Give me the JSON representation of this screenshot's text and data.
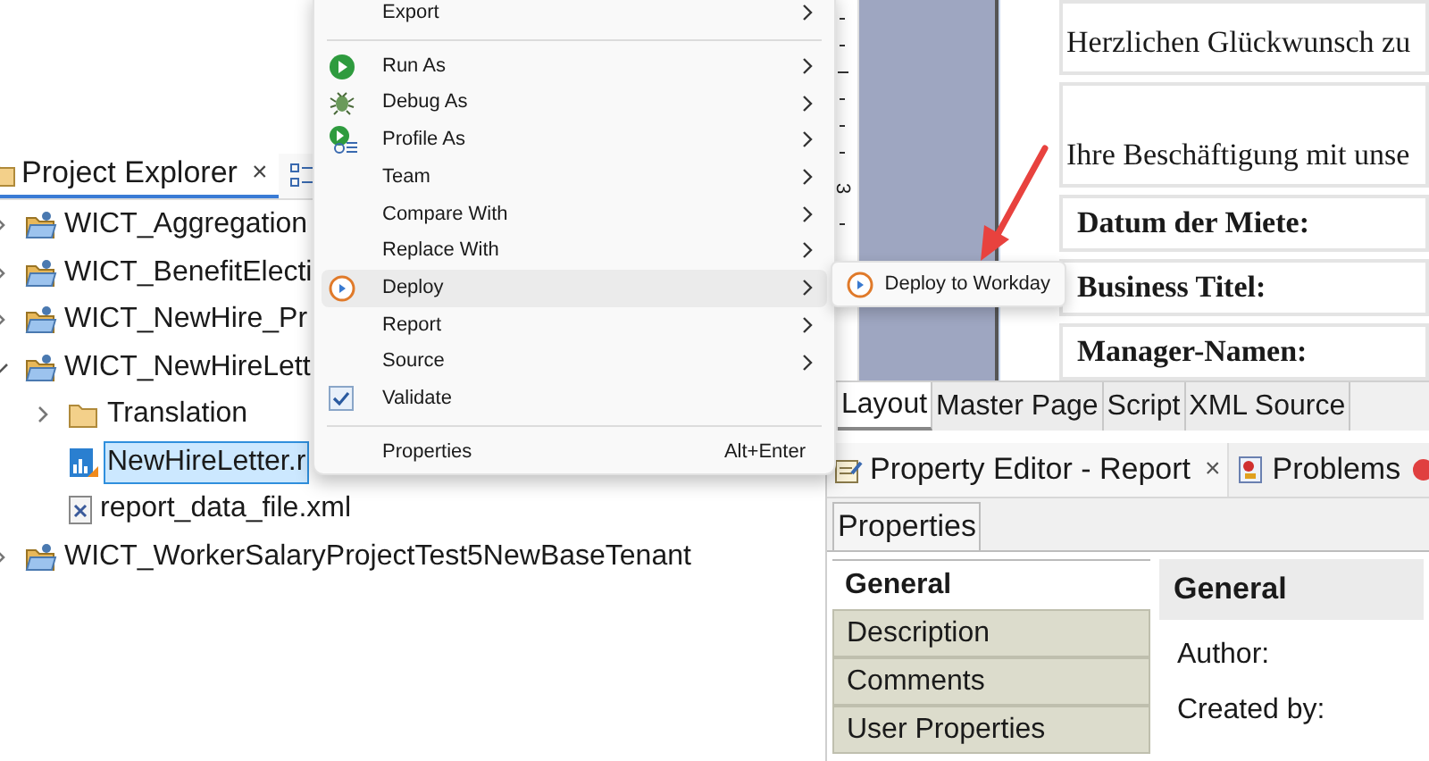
{
  "project_explorer": {
    "tab": {
      "label": "Project Explorer",
      "close": "×",
      "selected": true
    },
    "tree": [
      {
        "label": "WICT_Aggregation",
        "expanded": false
      },
      {
        "label": "WICT_BenefitElecti",
        "expanded": false
      },
      {
        "label": "WICT_NewHire_Pr",
        "expanded": false
      },
      {
        "label": "WICT_NewHireLett",
        "expanded": true,
        "children": [
          {
            "label": "Translation",
            "kind": "folder",
            "expanded": false,
            "selected": false
          },
          {
            "label": "NewHireLetter.r",
            "kind": "report",
            "selected": true
          },
          {
            "label": "report_data_file.xml",
            "kind": "xml",
            "selected": false
          }
        ]
      },
      {
        "label": "WICT_WorkerSalaryProjectTest5NewBaseTenant",
        "expanded": false
      }
    ]
  },
  "context_menu": {
    "items": [
      {
        "kind": "item",
        "label": "Export",
        "submenu": true,
        "selected": false
      },
      {
        "kind": "separator"
      },
      {
        "kind": "item",
        "label": "Run As",
        "submenu": true,
        "selected": false
      },
      {
        "kind": "item",
        "label": "Debug As",
        "submenu": true,
        "selected": false
      },
      {
        "kind": "item",
        "label": "Profile As",
        "submenu": true,
        "selected": false
      },
      {
        "kind": "item",
        "label": "Team",
        "submenu": true,
        "selected": false
      },
      {
        "kind": "item",
        "label": "Compare With",
        "submenu": true,
        "selected": false
      },
      {
        "kind": "item",
        "label": "Replace With",
        "submenu": true,
        "selected": false
      },
      {
        "kind": "item",
        "label": "Deploy",
        "submenu": true,
        "selected": true
      },
      {
        "kind": "item",
        "label": "Report",
        "submenu": true,
        "selected": false
      },
      {
        "kind": "item",
        "label": "Source",
        "submenu": true,
        "selected": false
      },
      {
        "kind": "item",
        "label": "Validate",
        "submenu": false,
        "selected": false
      },
      {
        "kind": "separator"
      },
      {
        "kind": "item",
        "label": "Properties",
        "submenu": false,
        "selected": false,
        "shortcut": "Alt+Enter"
      }
    ],
    "submenu": {
      "items": [
        {
          "label": "Deploy to Workday",
          "selected": false
        }
      ]
    }
  },
  "report_canvas": {
    "ruler_label": "3",
    "blocks": [
      {
        "kind": "text",
        "label": "Herzlichen Glückwunsch zu"
      },
      {
        "kind": "text",
        "label": "Ihre Beschäftigung mit unse"
      },
      {
        "kind": "field",
        "label": "Datum der Miete:"
      },
      {
        "kind": "field",
        "label": "Business Titel:"
      },
      {
        "kind": "field",
        "label": "Manager-Namen:"
      }
    ]
  },
  "editor_tabs": [
    {
      "label": "Layout",
      "selected": true
    },
    {
      "label": "Master Page",
      "selected": false
    },
    {
      "label": "Script",
      "selected": false
    },
    {
      "label": "XML Source",
      "selected": false
    }
  ],
  "property_view": {
    "tabs": [
      {
        "label": "Property Editor - Report",
        "close": "×",
        "selected": true
      },
      {
        "label": "Problems",
        "selected": false
      }
    ],
    "subtab": "Properties",
    "categories": [
      {
        "label": "General",
        "selected": true
      },
      {
        "label": "Description",
        "selected": false
      },
      {
        "label": "Comments",
        "selected": false
      },
      {
        "label": "User Properties",
        "selected": false
      }
    ],
    "section_title": "General",
    "fields": [
      "Author:",
      "Created by:"
    ]
  }
}
